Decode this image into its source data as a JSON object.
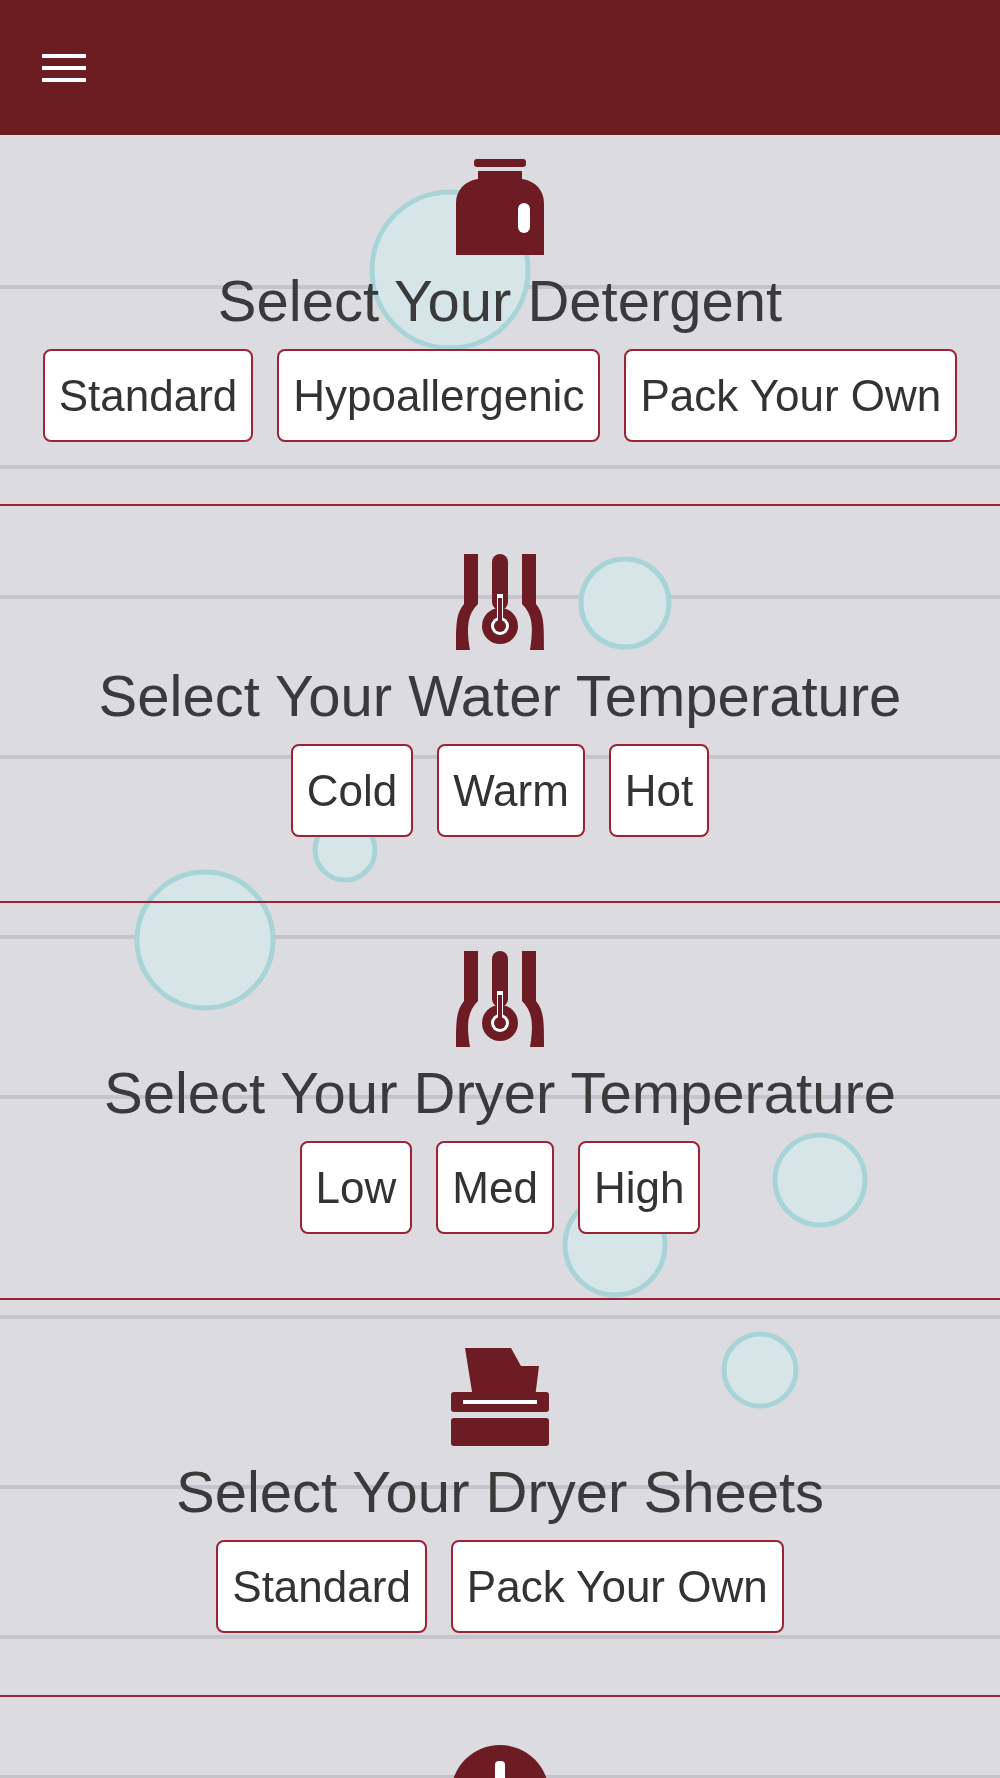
{
  "sections": [
    {
      "kind": "detergent",
      "title": "Select Your Detergent",
      "options": [
        {
          "label": "Standard",
          "selected": false
        },
        {
          "label": "Hypoallergenic",
          "selected": false
        },
        {
          "label": "Pack Your Own",
          "selected": false
        }
      ]
    },
    {
      "kind": "temperature",
      "title": "Select Your Water Temperature",
      "options": [
        {
          "label": "Cold",
          "selected": false
        },
        {
          "label": "Warm",
          "selected": false
        },
        {
          "label": "Hot",
          "selected": false
        }
      ]
    },
    {
      "kind": "temperature",
      "title": "Select Your Dryer Temperature",
      "options": [
        {
          "label": "Low",
          "selected": false
        },
        {
          "label": "Med",
          "selected": false
        },
        {
          "label": "High",
          "selected": false
        }
      ]
    },
    {
      "kind": "sheets",
      "title": "Select Your Dryer Sheets",
      "options": [
        {
          "label": "Standard",
          "selected": false
        },
        {
          "label": "Pack Your Own",
          "selected": false
        }
      ]
    },
    {
      "kind": "alert"
    }
  ]
}
